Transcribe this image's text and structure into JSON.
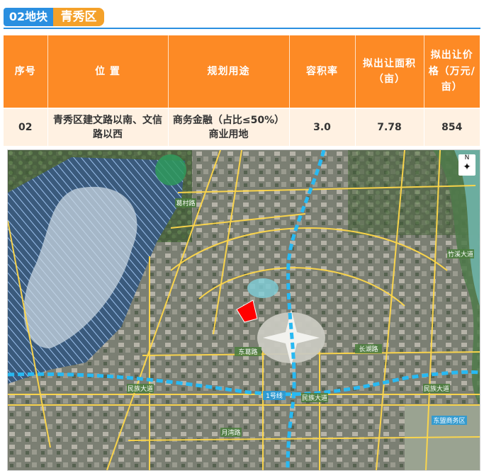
{
  "header": {
    "block_label": "02地块",
    "district_label": "青秀区"
  },
  "table": {
    "columns": [
      "序号",
      "位 置",
      "规划用途",
      "容积率",
      "拟出让面积（亩）",
      "拟出让价格（万元/亩）"
    ],
    "rows": [
      {
        "no": "02",
        "location": "青秀区建文路以南、文信路以西",
        "use_line1": "商务金融（占比≤50%）",
        "use_line2": "商业用地",
        "far": "3.0",
        "area": "7.78",
        "price": "854"
      }
    ]
  },
  "map": {
    "compass_label": "N",
    "road_labels": [
      "民族大道",
      "1号线",
      "民族大道",
      "民族大道",
      "东葛路",
      "长湖路",
      "竹溪大道",
      "月湾路",
      "葛村路",
      "东盟商务区"
    ],
    "colors": {
      "site": "#ff0000",
      "metro": "#28b9f2",
      "roads": "#ffd84a",
      "lake_hatch": "#4a86d9"
    }
  }
}
